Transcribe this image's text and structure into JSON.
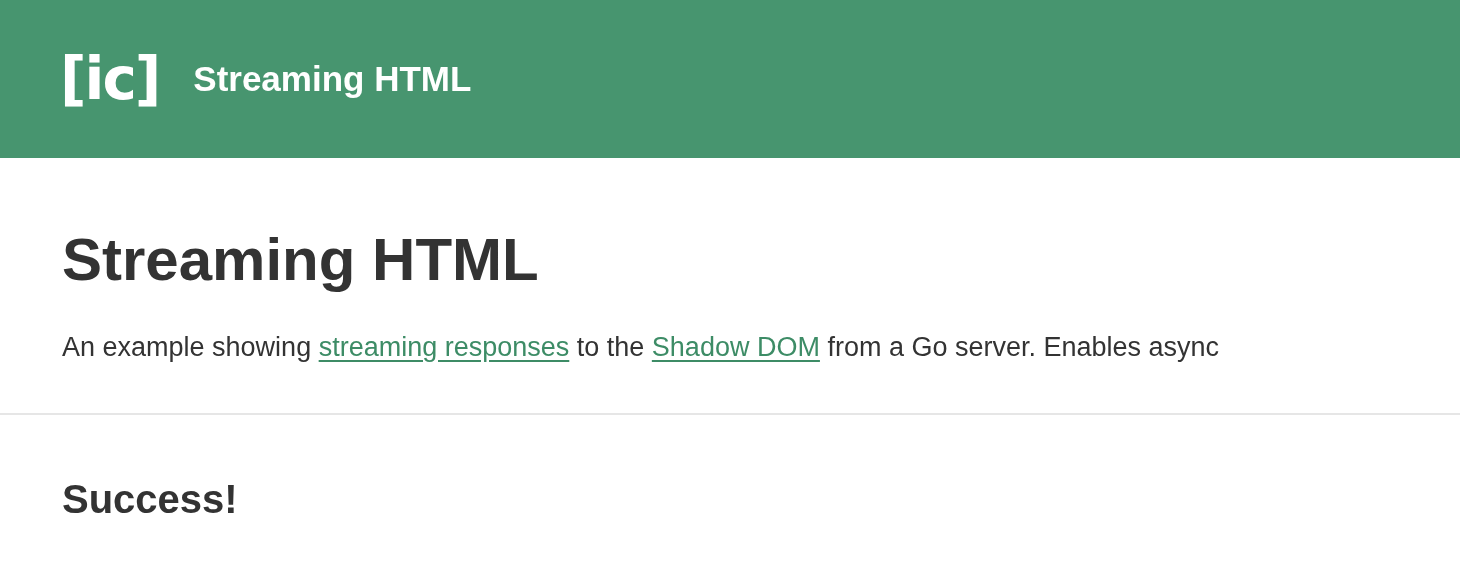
{
  "header": {
    "logo": "[ic]",
    "title": "Streaming HTML"
  },
  "heading": "Streaming HTML",
  "intro": [
    {
      "kind": "text",
      "text": "An example showing "
    },
    {
      "kind": "link",
      "text": "streaming responses"
    },
    {
      "kind": "text",
      "text": " to the "
    },
    {
      "kind": "link",
      "text": "Shadow DOM"
    },
    {
      "kind": "text",
      "text": " from a Go server. Enables async"
    }
  ],
  "result": {
    "heading": "Success!"
  }
}
